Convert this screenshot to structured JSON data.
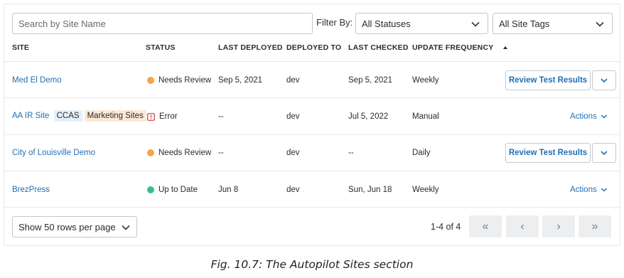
{
  "filters": {
    "search_placeholder": "Search by Site Name",
    "filter_by_label": "Filter By:",
    "status_selected": "All Statuses",
    "tags_selected": "All Site Tags"
  },
  "table": {
    "headers": {
      "site": "SITE",
      "status": "STATUS",
      "last_deployed": "LAST DEPLOYED",
      "deployed_to": "DEPLOYED TO",
      "last_checked": "LAST CHECKED",
      "update_frequency": "UPDATE FREQUENCY"
    },
    "sort_indicator": "ascending",
    "rows": [
      {
        "site": "Med El Demo",
        "tags": [],
        "status": "Needs Review",
        "status_color": "#f5a54a",
        "last_deployed": "Sep 5, 2021",
        "deployed_to": "dev",
        "last_checked": "Sep 5, 2021",
        "update_frequency": "Weekly",
        "action_label": "Review Test Results"
      },
      {
        "site": "AA IR Site",
        "tags": [
          "CCAS",
          "Marketing Sites"
        ],
        "status": "Error",
        "status_color": "#d9363e",
        "last_deployed": "--",
        "deployed_to": "dev",
        "last_checked": "Jul 5, 2022",
        "update_frequency": "Manual",
        "action_label": "Actions"
      },
      {
        "site": "City of Louisville Demo",
        "tags": [],
        "status": "Needs Review",
        "status_color": "#f5a54a",
        "last_deployed": "--",
        "deployed_to": "dev",
        "last_checked": "--",
        "update_frequency": "Daily",
        "action_label": "Review Test Results"
      },
      {
        "site": "BrezPress",
        "tags": [],
        "status": "Up to Date",
        "status_color": "#3bbf8a",
        "last_deployed": "Jun 8",
        "deployed_to": "dev",
        "last_checked": "Sun, Jun 18",
        "update_frequency": "Weekly",
        "action_label": "Actions"
      }
    ]
  },
  "footer": {
    "rows_per_page": "Show 50 rows per page",
    "range_text": "1-4 of 4",
    "pagination": {
      "first": "«",
      "prev": "‹",
      "next": "›",
      "last": "»"
    }
  },
  "caption": "Fig. 10.7: The Autopilot Sites section",
  "colors": {
    "link": "#1f6fb5",
    "needs_review": "#f5a54a",
    "error": "#d9363e",
    "up_to_date": "#3bbf8a"
  }
}
